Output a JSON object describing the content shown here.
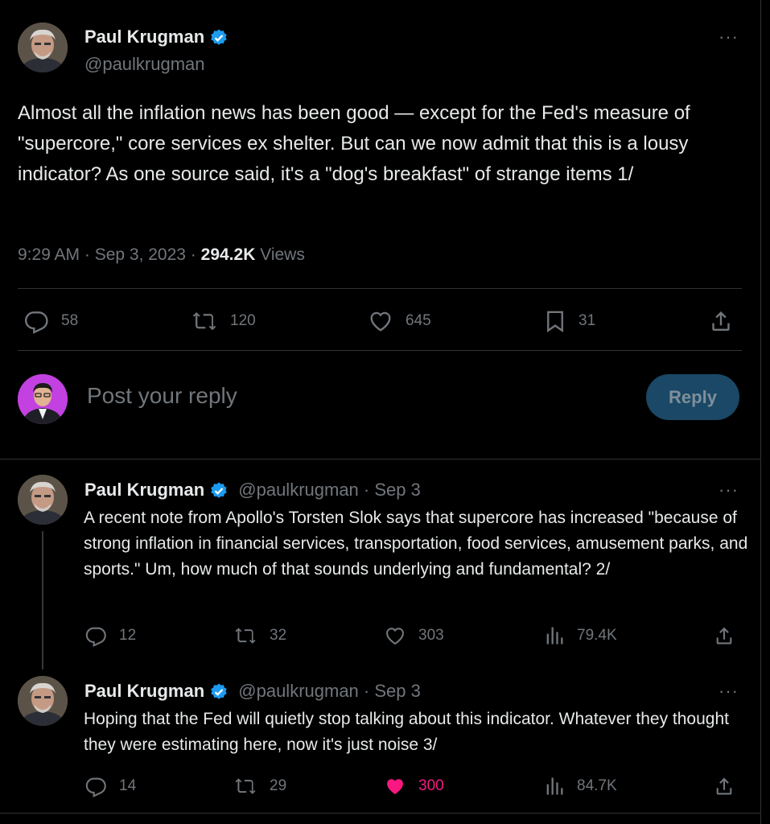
{
  "main_tweet": {
    "author": "Paul Krugman",
    "handle": "@paulkrugman",
    "text": "Almost all the inflation news has been good — except for the Fed's measure of \"supercore,\" core services ex shelter. But can we now admit that this is a lousy indicator? As one source said, it's a \"dog's breakfast\" of strange items 1/",
    "time": "9:29 AM · Sep 3, 2023 · ",
    "views_count": "294.2K",
    "views_label": " Views",
    "replies": "58",
    "retweets": "120",
    "likes": "645",
    "bookmarks": "31"
  },
  "compose": {
    "placeholder": "Post your reply",
    "button": "Reply"
  },
  "replies": [
    {
      "author": "Paul Krugman",
      "meta": "@paulkrugman · Sep 3",
      "text": "A recent note from Apollo's Torsten Slok says that supercore has increased \"because of strong inflation in financial services, transportation, food services, amusement parks, and sports.\" Um, how much of that sounds underlying and fundamental? 2/",
      "replies": "12",
      "retweets": "32",
      "likes": "303",
      "views": "79.4K"
    },
    {
      "author": "Paul Krugman",
      "meta": "@paulkrugman · Sep 3",
      "text": "Hoping that the Fed will quietly stop talking about this indicator. Whatever they thought they were estimating here, now it's just noise 3/",
      "replies": "14",
      "retweets": "29",
      "likes": "300",
      "views": "84.7K"
    }
  ],
  "icons": {
    "more": "···",
    "verified_color": "#1d9bf0",
    "like_active_color": "#f91880"
  }
}
